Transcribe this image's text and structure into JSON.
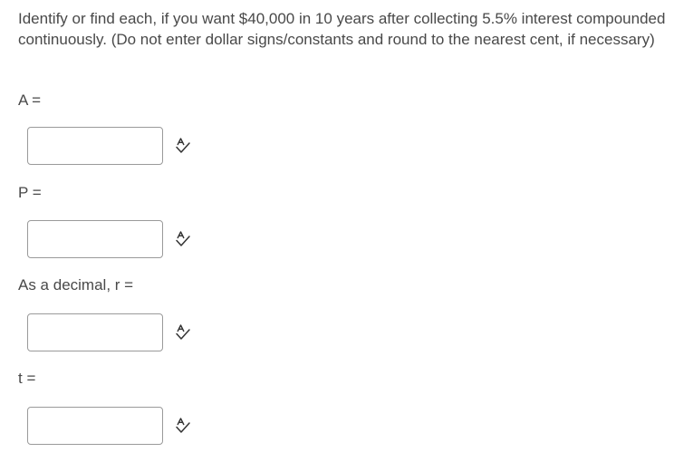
{
  "question": {
    "text": "Identify or find each, if you want $40,000 in 10 years after collecting 5.5% interest compounded continuously. (Do not enter dollar signs/constants and round to the nearest cent, if necessary)"
  },
  "fields": [
    {
      "label": "A =",
      "value": "",
      "icon": "spellcheck-icon"
    },
    {
      "label": "P =",
      "value": "",
      "icon": "spellcheck-icon"
    },
    {
      "label": "As a decimal, r =",
      "value": "",
      "icon": "spellcheck-icon"
    },
    {
      "label": "t =",
      "value": "",
      "icon": "spellcheck-icon"
    }
  ],
  "colors": {
    "text": "#494949",
    "input_border": "#9a9a9a",
    "icon": "#333333"
  }
}
